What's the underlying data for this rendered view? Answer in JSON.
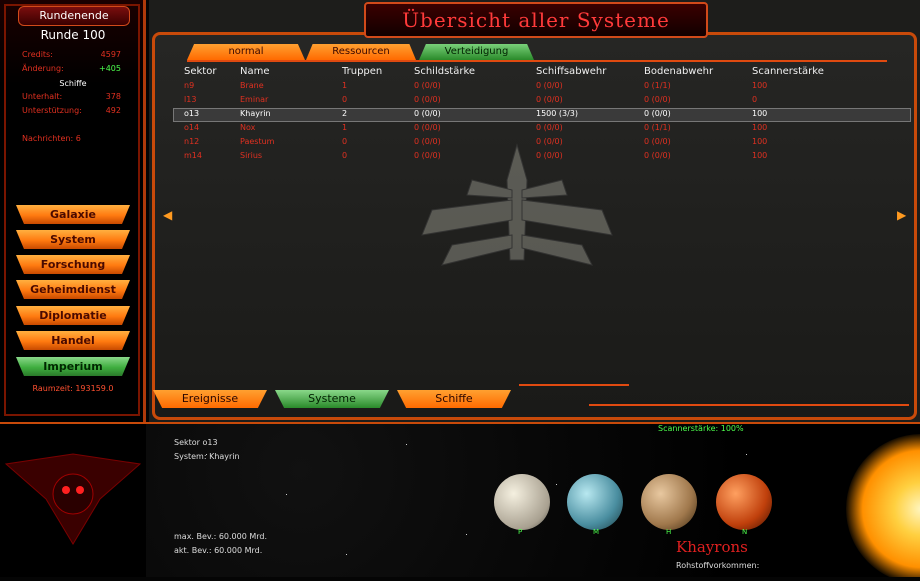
{
  "left_panel": {
    "end_turn_label": "Rundenende",
    "round_label": "Runde 100",
    "stats": [
      {
        "label": "Credits:",
        "value": "4597"
      },
      {
        "label": "Änderung:",
        "value": "+405"
      }
    ],
    "ships_header": "Schiffe",
    "ship_stats": [
      {
        "label": "Unterhalt:",
        "value": "378"
      },
      {
        "label": "Unterstützung:",
        "value": "492"
      }
    ],
    "messages": "Nachrichten: 6",
    "nav": [
      "Galaxie",
      "System",
      "Forschung",
      "Geheimdienst",
      "Diplomatie",
      "Handel",
      "Imperium"
    ],
    "active_nav": "Imperium",
    "raumzeit": "Raumzeit: 193159.0"
  },
  "main": {
    "title": "Übersicht aller Systeme",
    "tabs": [
      "normal",
      "Ressourcen",
      "Verteidigung"
    ],
    "active_tab": "Verteidigung",
    "columns": [
      "Sektor",
      "Name",
      "Truppen",
      "Schildstärke",
      "Schiffsabwehr",
      "Bodenabwehr",
      "Scannerstärke"
    ],
    "rows": [
      [
        "n9",
        "Brane",
        "1",
        "0 (0/0)",
        "0 (0/0)",
        "0 (1/1)",
        "100"
      ],
      [
        "l13",
        "Eminar",
        "0",
        "0 (0/0)",
        "0 (0/0)",
        "0 (0/0)",
        "0"
      ],
      [
        "o13",
        "Khayrin",
        "2",
        "0 (0/0)",
        "1500 (3/3)",
        "0 (0/0)",
        "100"
      ],
      [
        "o14",
        "Nox",
        "1",
        "0 (0/0)",
        "0 (0/0)",
        "0 (1/1)",
        "100"
      ],
      [
        "n12",
        "Paestum",
        "0",
        "0 (0/0)",
        "0 (0/0)",
        "0 (0/0)",
        "100"
      ],
      [
        "m14",
        "Sirius",
        "0",
        "0 (0/0)",
        "0 (0/0)",
        "0 (0/0)",
        "100"
      ]
    ],
    "selected_row": 2,
    "bottom_tabs": [
      "Ereignisse",
      "Systeme",
      "Schiffe"
    ],
    "active_bottom_tab": "Systeme"
  },
  "system_view": {
    "sector": "Sektor o13",
    "system": "System: Khayrin",
    "scanner": "Scannerstärke: 100%",
    "max_pop": "max. Bev.: 60.000 Mrd.",
    "cur_pop": "akt. Bev.: 60.000 Mrd.",
    "race_name": "Khayrons",
    "resources_label": "Rohstoffvorkommen:",
    "planets": [
      {
        "label": "P",
        "color": "#d8d0c0"
      },
      {
        "label": "M",
        "color": "#5ea8b8"
      },
      {
        "label": "H",
        "color": "#b88a60"
      },
      {
        "label": "N",
        "color": "#d2541c"
      }
    ]
  }
}
